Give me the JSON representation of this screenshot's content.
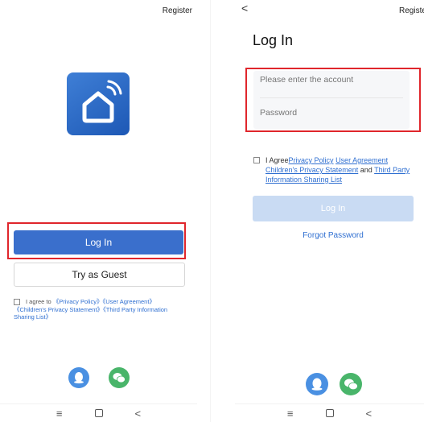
{
  "left": {
    "register_label": "Register",
    "login_label": "Log In",
    "guest_label": "Try as Guest",
    "agreement": {
      "prefix": "I agree to ",
      "privacy_policy": "《Privacy Policy》",
      "user_agreement": "《User Agreement》",
      "children_privacy": "《Children's Privacy Statement》",
      "third_party": "《Third Party Information Sharing List》"
    },
    "social": [
      "qq-icon",
      "wechat-icon"
    ]
  },
  "right": {
    "back_label": "<",
    "register_label": "Register",
    "title": "Log In",
    "account_placeholder": "Please enter the account",
    "password_placeholder": "Password",
    "agreement": {
      "prefix": "I Agree",
      "privacy_policy": "Privacy Policy",
      "user_agreement": "User Agreement",
      "children_privacy": "Children's Privacy Statement",
      "and": " and ",
      "third_party": "Third Party Information Sharing List"
    },
    "login_label": "Log In",
    "forgot_label": "Forgot Password",
    "social": [
      "qq-icon",
      "wechat-icon"
    ]
  },
  "navbar": {
    "menu": "≡",
    "back": "<"
  },
  "colors": {
    "primary": "#3a6fcc",
    "disabled_button": "#c9dbf3",
    "link": "#2f6fd1",
    "highlight": "#e0262c",
    "qq": "#4a90e2",
    "wechat": "#49b56a"
  }
}
